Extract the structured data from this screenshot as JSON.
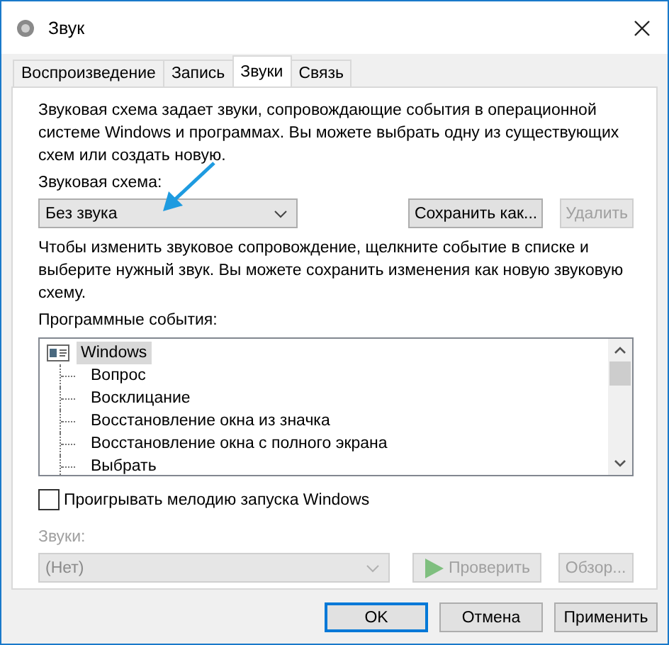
{
  "window": {
    "title": "Звук"
  },
  "tabs": [
    {
      "label": "Воспроизведение",
      "selected": false
    },
    {
      "label": "Запись",
      "selected": false
    },
    {
      "label": "Звуки",
      "selected": true
    },
    {
      "label": "Связь",
      "selected": false
    }
  ],
  "description": "Звуковая схема задает звуки, сопровождающие события в операционной системе Windows и программах. Вы можете выбрать одну из существующих схем или создать новую.",
  "scheme": {
    "label": "Звуковая схема:",
    "value": "Без звука"
  },
  "scheme_buttons": [
    {
      "label": "Сохранить как...",
      "disabled": false
    },
    {
      "label": "Удалить",
      "disabled": true
    }
  ],
  "hint": "Чтобы изменить звуковое сопровождение, щелкните событие в списке и выберите нужный звук. Вы можете сохранить изменения как новую звуковую схему.",
  "events": {
    "label": "Программные события:",
    "items": [
      {
        "label": "Windows",
        "selected": true,
        "children": [
          {
            "label": "Вопрос",
            "selected": false
          },
          {
            "label": "Восклицание",
            "selected": false
          },
          {
            "label": "Восстановление окна из значка",
            "selected": false
          },
          {
            "label": "Восстановление окна с полного экрана",
            "selected": false
          },
          {
            "label": "Выбрать",
            "selected": false
          }
        ]
      }
    ]
  },
  "startup_sound": {
    "label": "Проигрывать мелодию запуска Windows",
    "checked": false
  },
  "sounds": {
    "label": "Звуки:",
    "value": "(Нет)",
    "disabled": true
  },
  "sound_buttons": [
    {
      "label": "Проверить",
      "kind": "play",
      "disabled": true
    },
    {
      "label": "Обзор...",
      "kind": "plain",
      "disabled": true
    }
  ],
  "dialog_buttons": [
    {
      "label": "OK",
      "default": true
    },
    {
      "label": "Отмена",
      "default": false
    },
    {
      "label": "Применить",
      "default": false
    }
  ]
}
